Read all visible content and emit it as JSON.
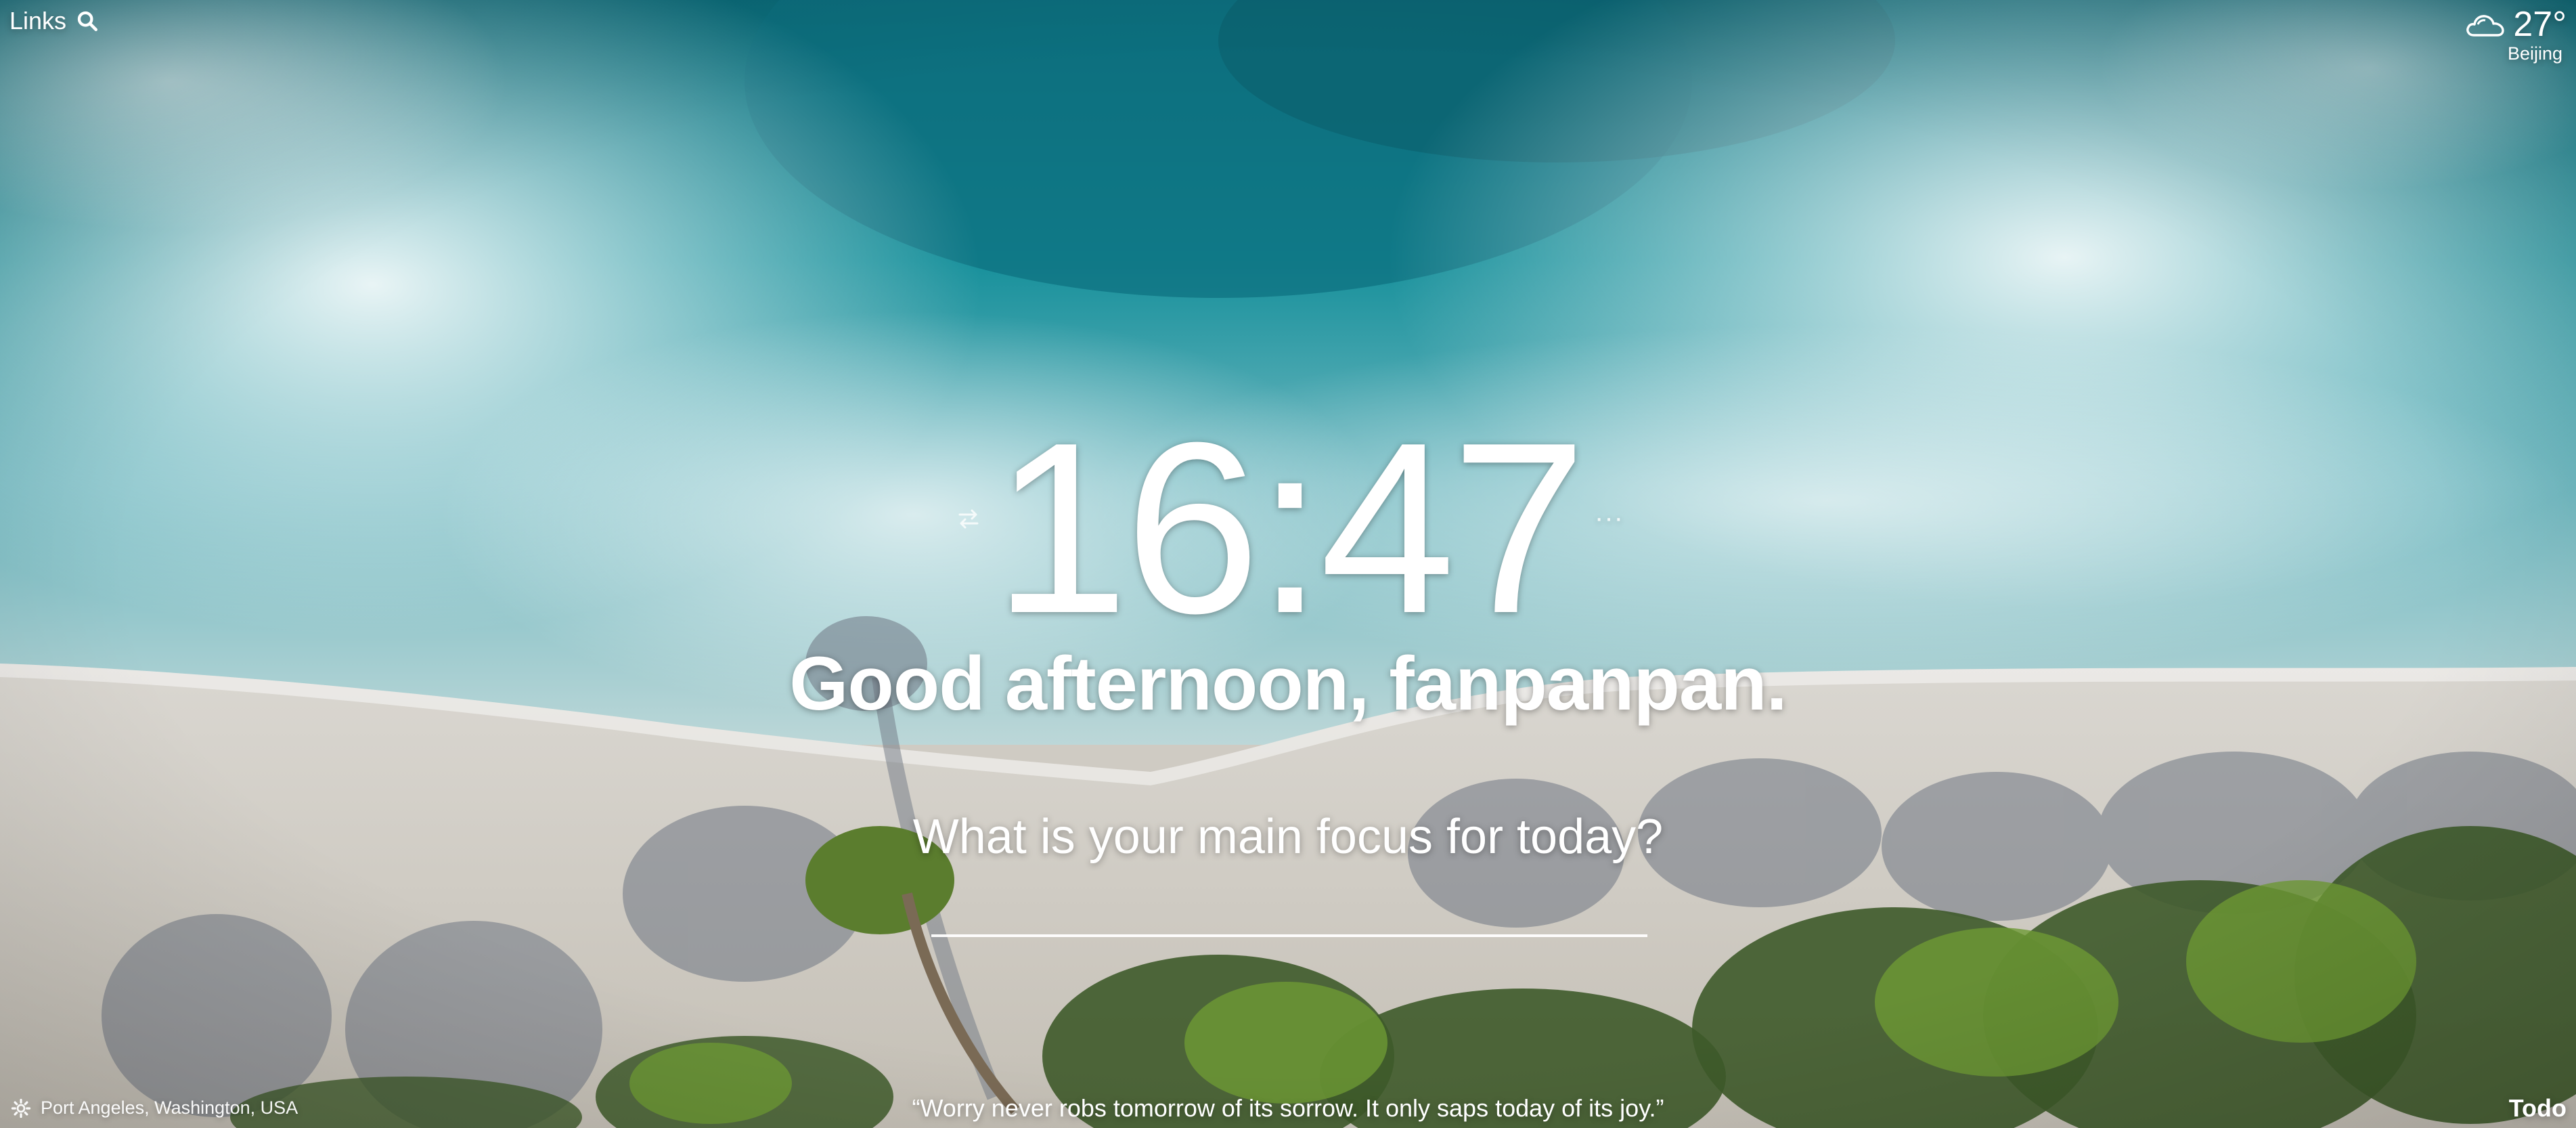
{
  "header": {
    "links_label": "Links",
    "search_icon": "search-icon"
  },
  "weather": {
    "icon": "cloud-icon",
    "temperature": "27°",
    "city": "Beijing"
  },
  "center": {
    "clock_time": "16:47",
    "greeting": "Good afternoon, fanpanpan.",
    "focus_question": "What is your main focus for today?",
    "focus_input_value": "",
    "toggle_icon": "swap-icon",
    "more_icon": "more-icon",
    "more_label": "···"
  },
  "footer": {
    "location_icon": "gear-icon",
    "location": "Port Angeles, Washington, USA",
    "quote": "“Worry never robs tomorrow of its sorrow. It only saps today of its joy.”",
    "todo_label": "Todo"
  },
  "colors": {
    "text": "#ffffff",
    "ocean_deep": "#0f7f8c",
    "sand": "#cdc8bf",
    "foliage": "#3e5a2a"
  }
}
